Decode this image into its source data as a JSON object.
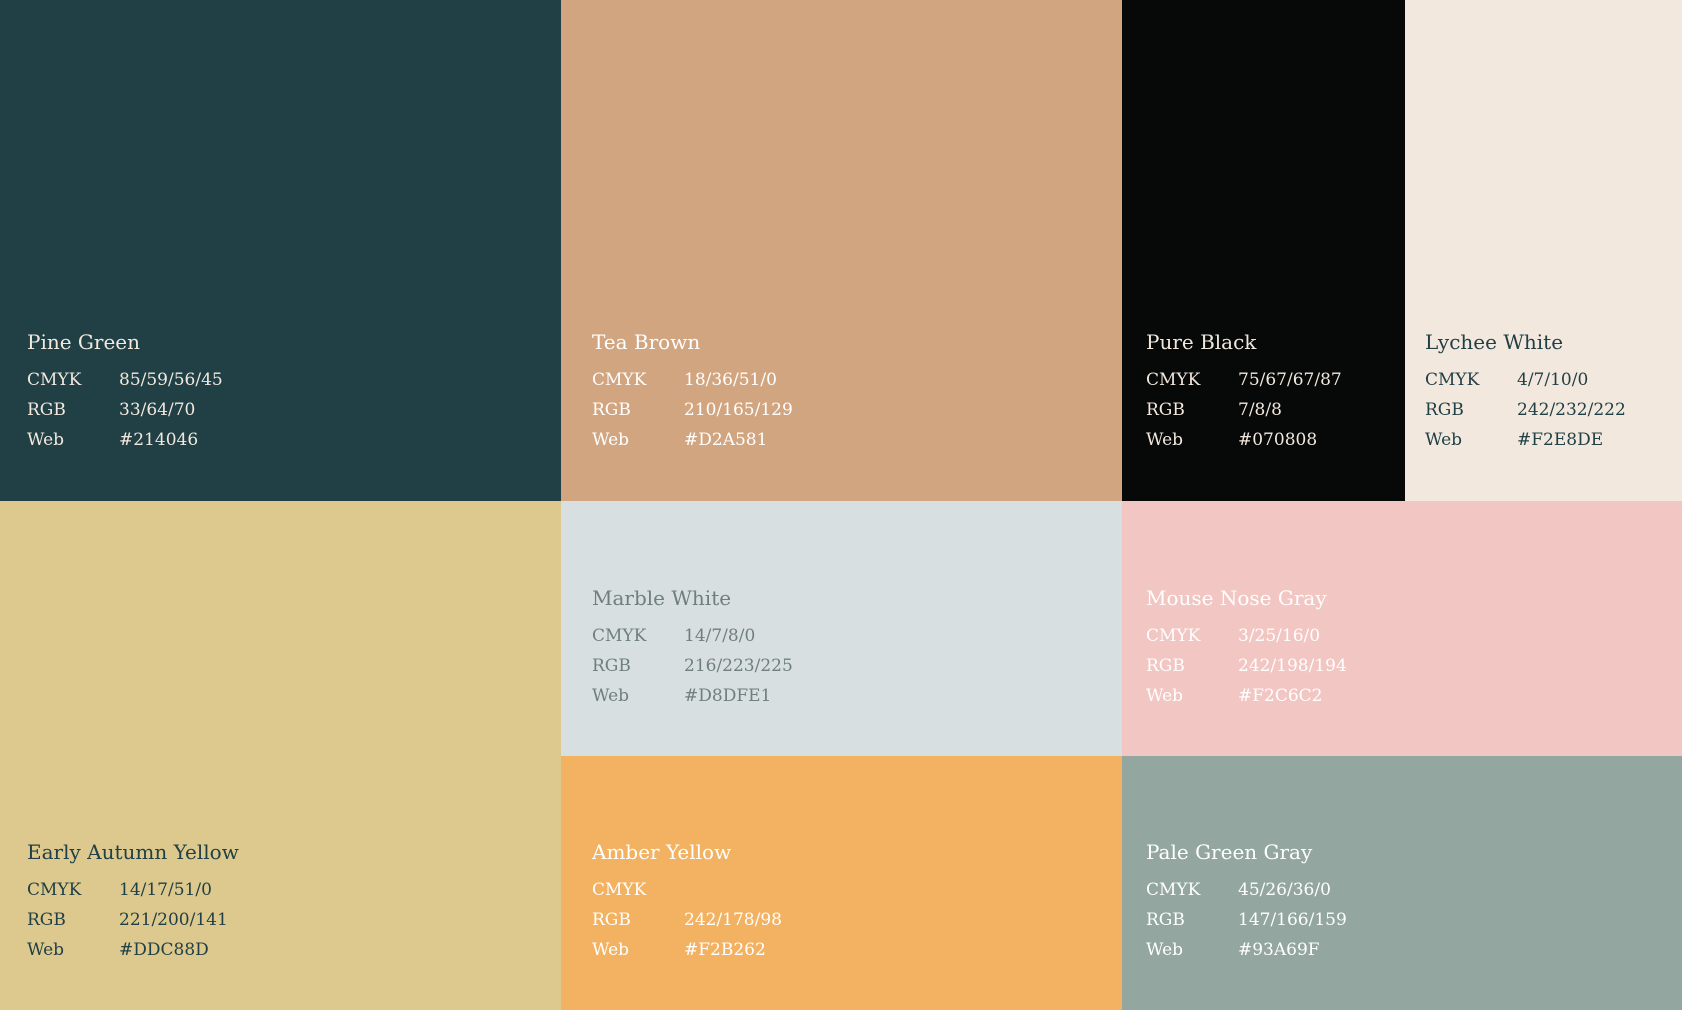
{
  "labels": {
    "cmyk": "CMYK",
    "rgb": "RGB",
    "web": "Web"
  },
  "swatches": [
    {
      "name": "Pine Green",
      "cmyk": "85/59/56/45",
      "rgb": "33/64/70",
      "web": "#214046",
      "color": "#214046",
      "text_color": "#F2E8DE"
    },
    {
      "name": "Tea Brown",
      "cmyk": "18/36/51/0",
      "rgb": "210/165/129",
      "web": "#D2A581",
      "color": "#D2A581",
      "text_color": "#FFFFFF"
    },
    {
      "name": "Pure Black",
      "cmyk": "75/67/67/87",
      "rgb": "7/8/8",
      "web": "#070808",
      "color": "#070808",
      "text_color": "#F2E8DE"
    },
    {
      "name": "Lychee White",
      "cmyk": "4/7/10/0",
      "rgb": "242/232/222",
      "web": "#F2E8DE",
      "color": "#F2E8DE",
      "text_color": "#214046"
    },
    {
      "name": "Early Autumn Yellow",
      "cmyk": "14/17/51/0",
      "rgb": "221/200/141",
      "web": "#DDC88D",
      "color": "#DDC88D",
      "text_color": "#214046"
    },
    {
      "name": "Marble White",
      "cmyk": "14/7/8/0",
      "rgb": "216/223/225",
      "web": "#D8DFE1",
      "color": "#D8DFE1",
      "text_color": "#6E7F7C"
    },
    {
      "name": "Mouse Nose Gray",
      "cmyk": "3/25/16/0",
      "rgb": "242/198/194",
      "web": "#F2C6C2",
      "color": "#F2C6C2",
      "text_color": "#FFFFFF"
    },
    {
      "name": "Amber Yellow",
      "cmyk": "",
      "rgb": "242/178/98",
      "web": "#F2B262",
      "color": "#F2B262",
      "text_color": "#FFFFFF"
    },
    {
      "name": "Pale Green Gray",
      "cmyk": "45/26/36/0",
      "rgb": "147/166/159",
      "web": "#93A69F",
      "color": "#93A69F",
      "text_color": "#FFFFFF"
    }
  ]
}
